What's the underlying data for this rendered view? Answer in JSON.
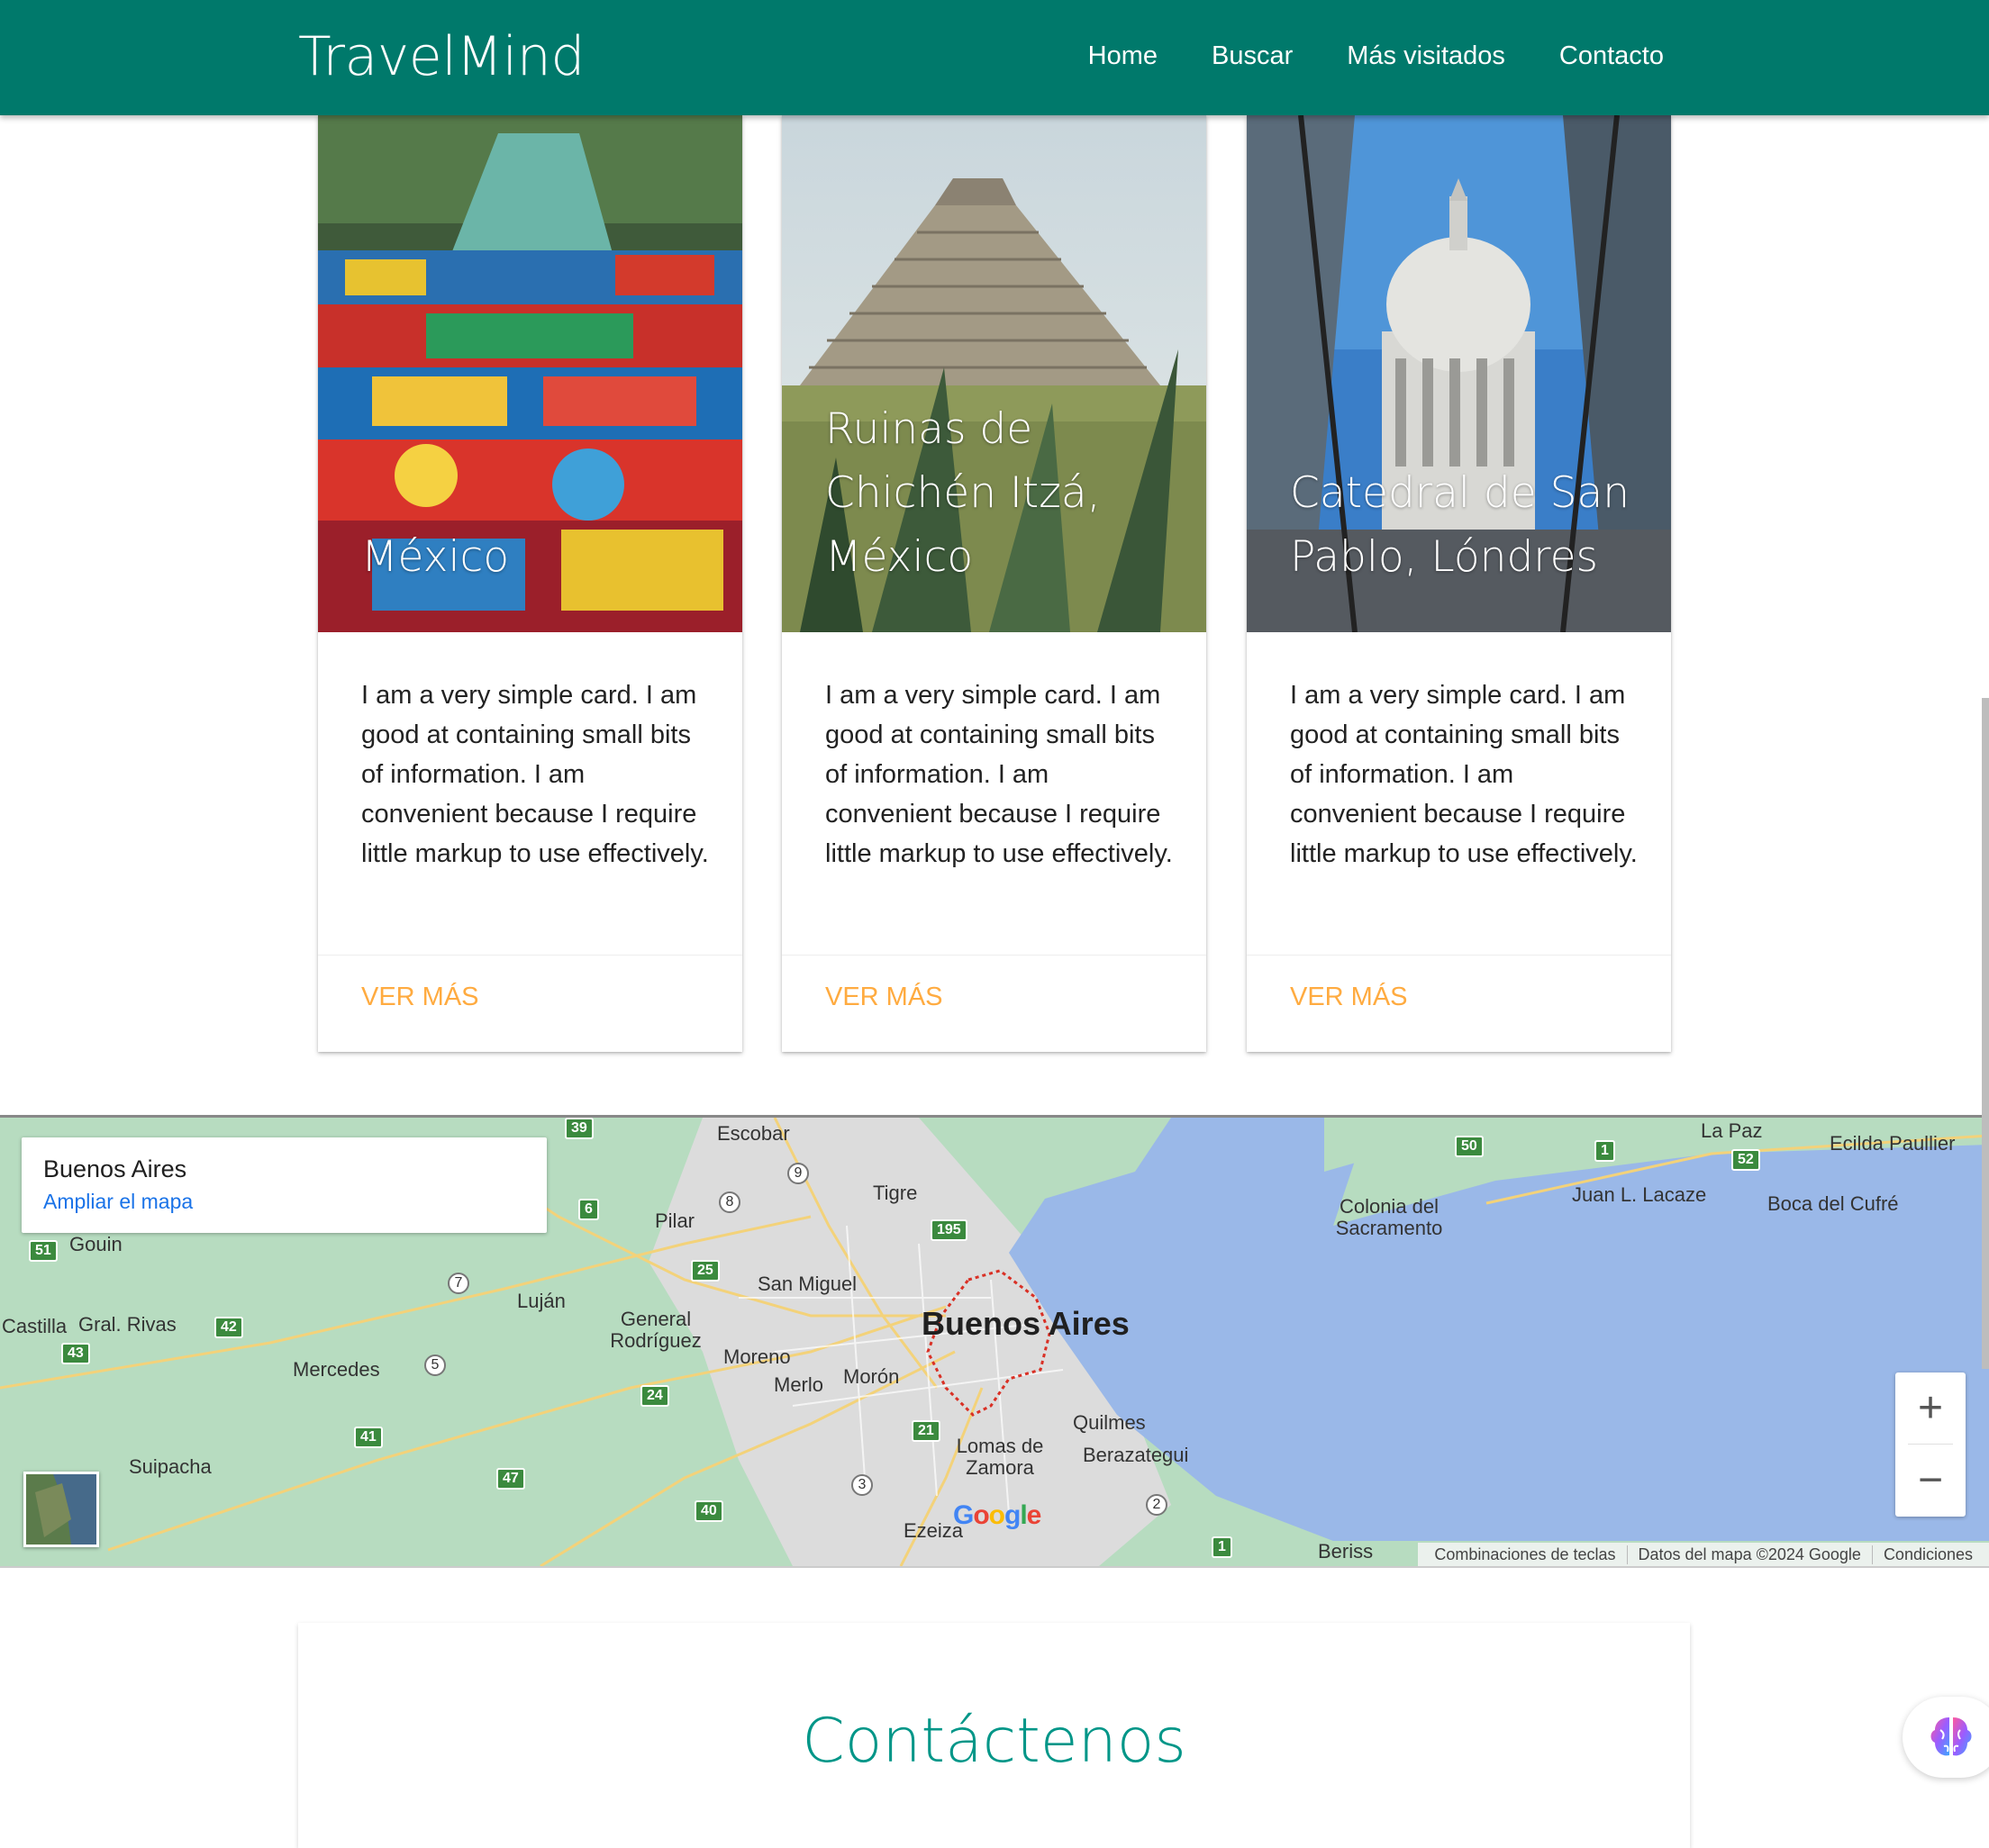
{
  "brand": "TravelMind",
  "nav": {
    "items": [
      {
        "label": "Home"
      },
      {
        "label": "Buscar"
      },
      {
        "label": "Más visitados"
      },
      {
        "label": "Contacto"
      }
    ]
  },
  "cards": [
    {
      "title": "México",
      "body": "I am a very simple card. I am good at containing small bits of information. I am convenient because I require little markup to use effectively.",
      "action": "Ver más"
    },
    {
      "title": "Ruinas de Chichén Itzá, México",
      "body": "I am a very simple card. I am good at containing small bits of information. I am convenient because I require little markup to use effectively.",
      "action": "Ver más"
    },
    {
      "title": "Catedral de San Pablo, Lóndres",
      "body": "I am a very simple card. I am good at containing small bits of information. I am convenient because I require little markup to use effectively.",
      "action": "Ver más"
    }
  ],
  "map": {
    "infobox_title": "Buenos Aires",
    "infobox_link": "Ampliar el mapa",
    "city_main": "Buenos Aires",
    "labels": [
      "Escobar",
      "Tigre",
      "Pilar",
      "San Miguel",
      "Luján",
      "General Rodríguez",
      "Moreno",
      "Merlo",
      "Morón",
      "Mercedes",
      "Gral. Rivas",
      "Suipacha",
      "Lomas de Zamora",
      "Quilmes",
      "Berazategui",
      "Ezeiza",
      "Colonia del Sacramento",
      "Juan L. Lacaze",
      "La Paz",
      "Ecilda Paullier",
      "Boca del Cufré",
      "Gouin",
      "Castilla",
      "Beriss"
    ],
    "zoom_in": "+",
    "zoom_out": "−",
    "google": "Google",
    "footer": [
      "Combinaciones de teclas",
      "Datos del mapa ©2024 Google",
      "Condiciones"
    ],
    "shields": [
      "39",
      "50",
      "52",
      "1",
      "195",
      "25",
      "42",
      "43",
      "51",
      "41",
      "24",
      "47",
      "21",
      "40",
      "6",
      "2",
      "8",
      "9",
      "7",
      "5",
      "3",
      "1"
    ]
  },
  "contact": {
    "title": "Contáctenos"
  },
  "colors": {
    "primary": "#00796b",
    "accent": "#ffab40",
    "contact_title": "#009688",
    "water": "#9ab8e8",
    "land": "#b7dcc0"
  },
  "icons": {
    "floating": "brain-icon"
  }
}
